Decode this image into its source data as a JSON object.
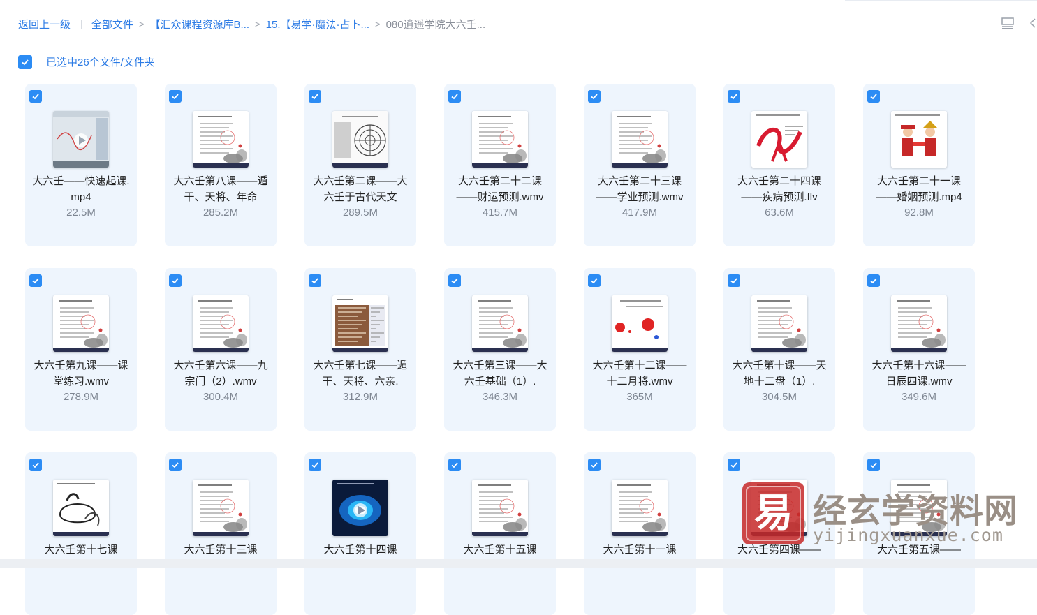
{
  "breadcrumb": {
    "back": "返回上一级",
    "items": [
      "全部文件",
      "【汇众课程资源库B...",
      "15.【易学·魔法·占卜...",
      "080逍遥学院大六壬..."
    ]
  },
  "selection": {
    "label": "已选中26个文件/文件夹"
  },
  "files": [
    {
      "name": "大六壬——快速起课.mp4",
      "size": "22.5M",
      "kind": "video"
    },
    {
      "name": "大六壬第八课——遁干、天将、年命",
      "size": "285.2M",
      "kind": "slide"
    },
    {
      "name": "大六壬第二课——大六壬于古代天文",
      "size": "289.5M",
      "kind": "chart"
    },
    {
      "name": "大六壬第二十二课——财运预测.wmv",
      "size": "415.7M",
      "kind": "slide"
    },
    {
      "name": "大六壬第二十三课——学业预测.wmv",
      "size": "417.9M",
      "kind": "slide"
    },
    {
      "name": "大六壬第二十四课——疾病预测.flv",
      "size": "63.6M",
      "kind": "ribbon"
    },
    {
      "name": "大六壬第二十一课——婚姻预测.mp4",
      "size": "92.8M",
      "kind": "wedding"
    },
    {
      "name": "大六壬第九课——课堂练习.wmv",
      "size": "278.9M",
      "kind": "slide"
    },
    {
      "name": "大六壬第六课——九宗门（2）.wmv",
      "size": "300.4M",
      "kind": "slide"
    },
    {
      "name": "大六壬第七课——遁干、天将、六亲.",
      "size": "312.9M",
      "kind": "table"
    },
    {
      "name": "大六壬第三课——大六壬基础（1）.",
      "size": "346.3M",
      "kind": "slide"
    },
    {
      "name": "大六壬第十二课——十二月将.wmv",
      "size": "365M",
      "kind": "reddots"
    },
    {
      "name": "大六壬第十课——天地十二盘（1）.",
      "size": "304.5M",
      "kind": "slide"
    },
    {
      "name": "大六壬第十六课——日辰四课.wmv",
      "size": "349.6M",
      "kind": "slide"
    },
    {
      "name": "大六壬第十七课",
      "size": "",
      "kind": "ink"
    },
    {
      "name": "大六壬第十三课",
      "size": "",
      "kind": "slide"
    },
    {
      "name": "大六壬第十四课",
      "size": "",
      "kind": "space"
    },
    {
      "name": "大六壬第十五课",
      "size": "",
      "kind": "slide"
    },
    {
      "name": "大六壬第十一课",
      "size": "",
      "kind": "slide"
    },
    {
      "name": "大六壬第四课——",
      "size": "",
      "kind": "slide"
    },
    {
      "name": "大六壬第五课——",
      "size": "",
      "kind": "slide"
    }
  ],
  "watermark": {
    "logo_char": "易",
    "title": "经玄学资料网",
    "url": "yijingxuanxue.com"
  },
  "colors": {
    "accent": "#2c8cf4",
    "card_bg": "#eef5fd",
    "link": "#2c7be5"
  }
}
